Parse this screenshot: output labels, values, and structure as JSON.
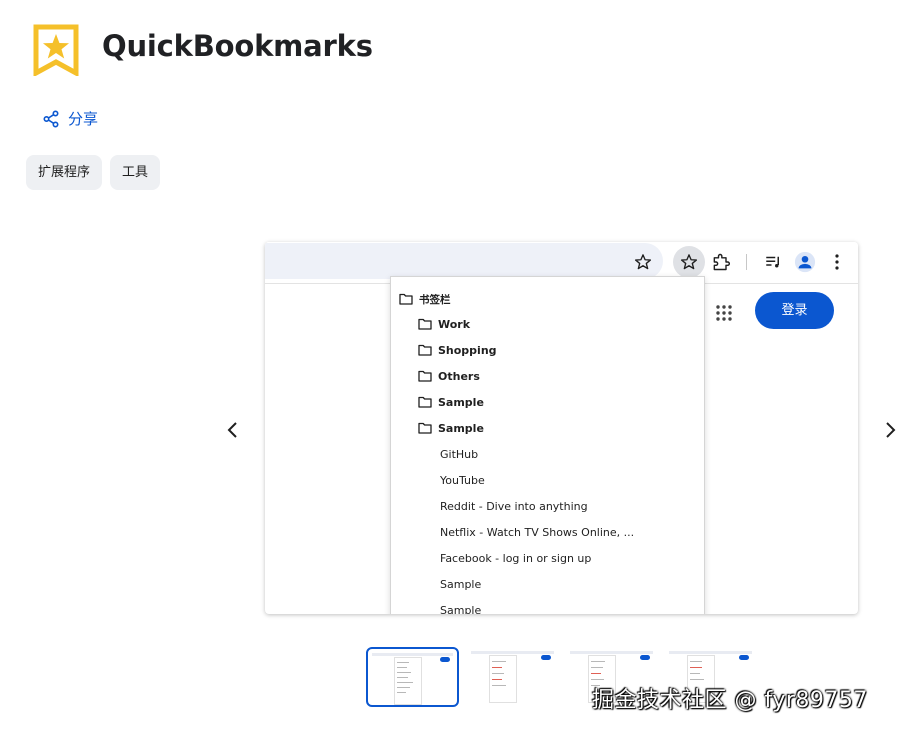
{
  "app": {
    "title": "QuickBookmarks",
    "brand_color": "#f5c02a"
  },
  "share": {
    "label": "分享",
    "icon": "share-icon"
  },
  "categories": [
    {
      "label": "扩展程序"
    },
    {
      "label": "工具"
    }
  ],
  "screenshot": {
    "signin_label": "登录",
    "bookmarks": {
      "root": "书签栏",
      "folders": [
        "Work",
        "Shopping",
        "Others",
        "Sample",
        "Sample"
      ],
      "links": [
        "GitHub",
        "YouTube",
        "Reddit - Dive into anything",
        "Netflix - Watch TV Shows Online, ...",
        "Facebook - log in or sign up",
        "Sample",
        "Sample"
      ]
    }
  },
  "carousel": {
    "thumbnail_count": 4,
    "active_index": 0
  },
  "watermark": "掘金技术社区 @ fyr89757",
  "colors": {
    "accent": "#0b57d0",
    "chip_bg": "#eef0f3"
  }
}
